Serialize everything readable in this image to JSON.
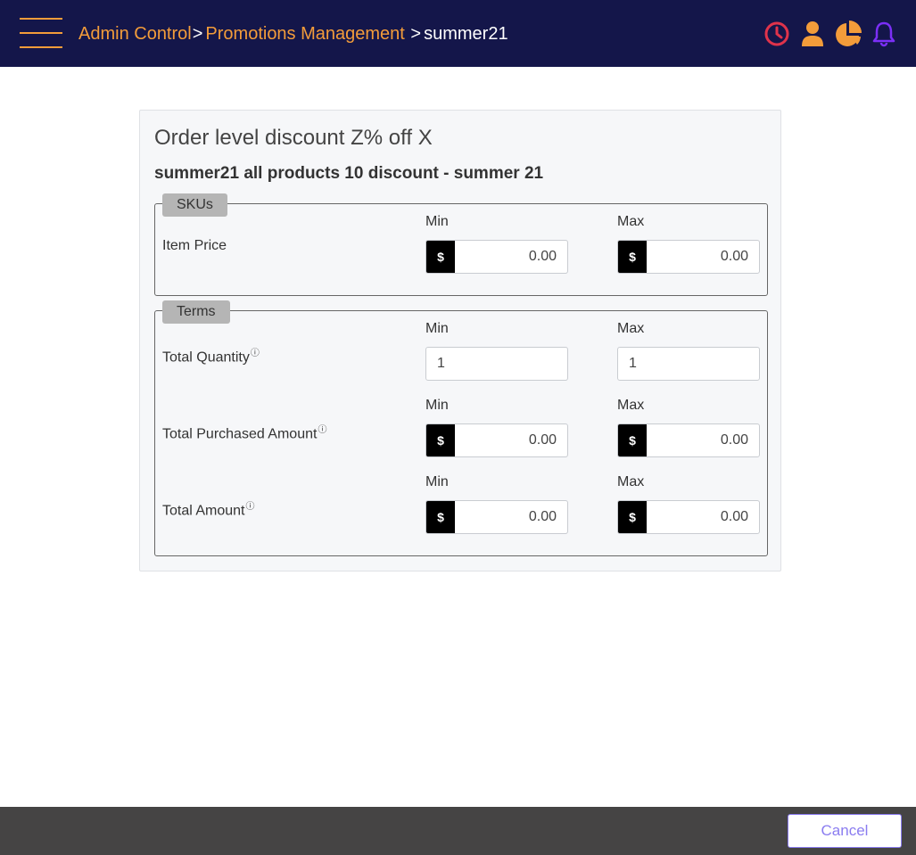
{
  "header": {
    "menu_icon": "hamburger-menu-icon",
    "breadcrumb": {
      "item1": "Admin Control",
      "sep1": ">",
      "item2": "Promotions Management",
      "sep2": ">",
      "current": "summer21"
    },
    "icons": [
      "clock-icon",
      "user-icon",
      "pie-chart-icon",
      "bell-icon"
    ]
  },
  "card": {
    "title": "Order level discount Z% off X",
    "subtitle": "summer21 all products 10 discount - summer 21"
  },
  "skus": {
    "legend": "SKUs",
    "rows": [
      {
        "label": "Item Price",
        "min_label": "Min",
        "max_label": "Max",
        "prefix": "$",
        "min_value": "0.00",
        "max_value": "0.00"
      }
    ]
  },
  "terms": {
    "legend": "Terms",
    "help_icon": "?",
    "rows": [
      {
        "label": "Total Quantity",
        "min_label": "Min",
        "max_label": "Max",
        "min_value": "1",
        "max_value": "1"
      },
      {
        "label": "Total Purchased Amount",
        "min_label": "Min",
        "max_label": "Max",
        "prefix": "$",
        "min_value": "0.00",
        "max_value": "0.00"
      },
      {
        "label": "Total Amount",
        "min_label": "Min",
        "max_label": "Max",
        "prefix": "$",
        "min_value": "0.00",
        "max_value": "0.00"
      }
    ]
  },
  "footer": {
    "cancel_label": "Cancel"
  },
  "colors": {
    "topbar": "#14164a",
    "accent_orange": "#f39c3a",
    "clock_red": "#e0334b",
    "bell_purple": "#7b2ff7",
    "footer": "#454444",
    "cancel_text": "#8a7cf0"
  }
}
